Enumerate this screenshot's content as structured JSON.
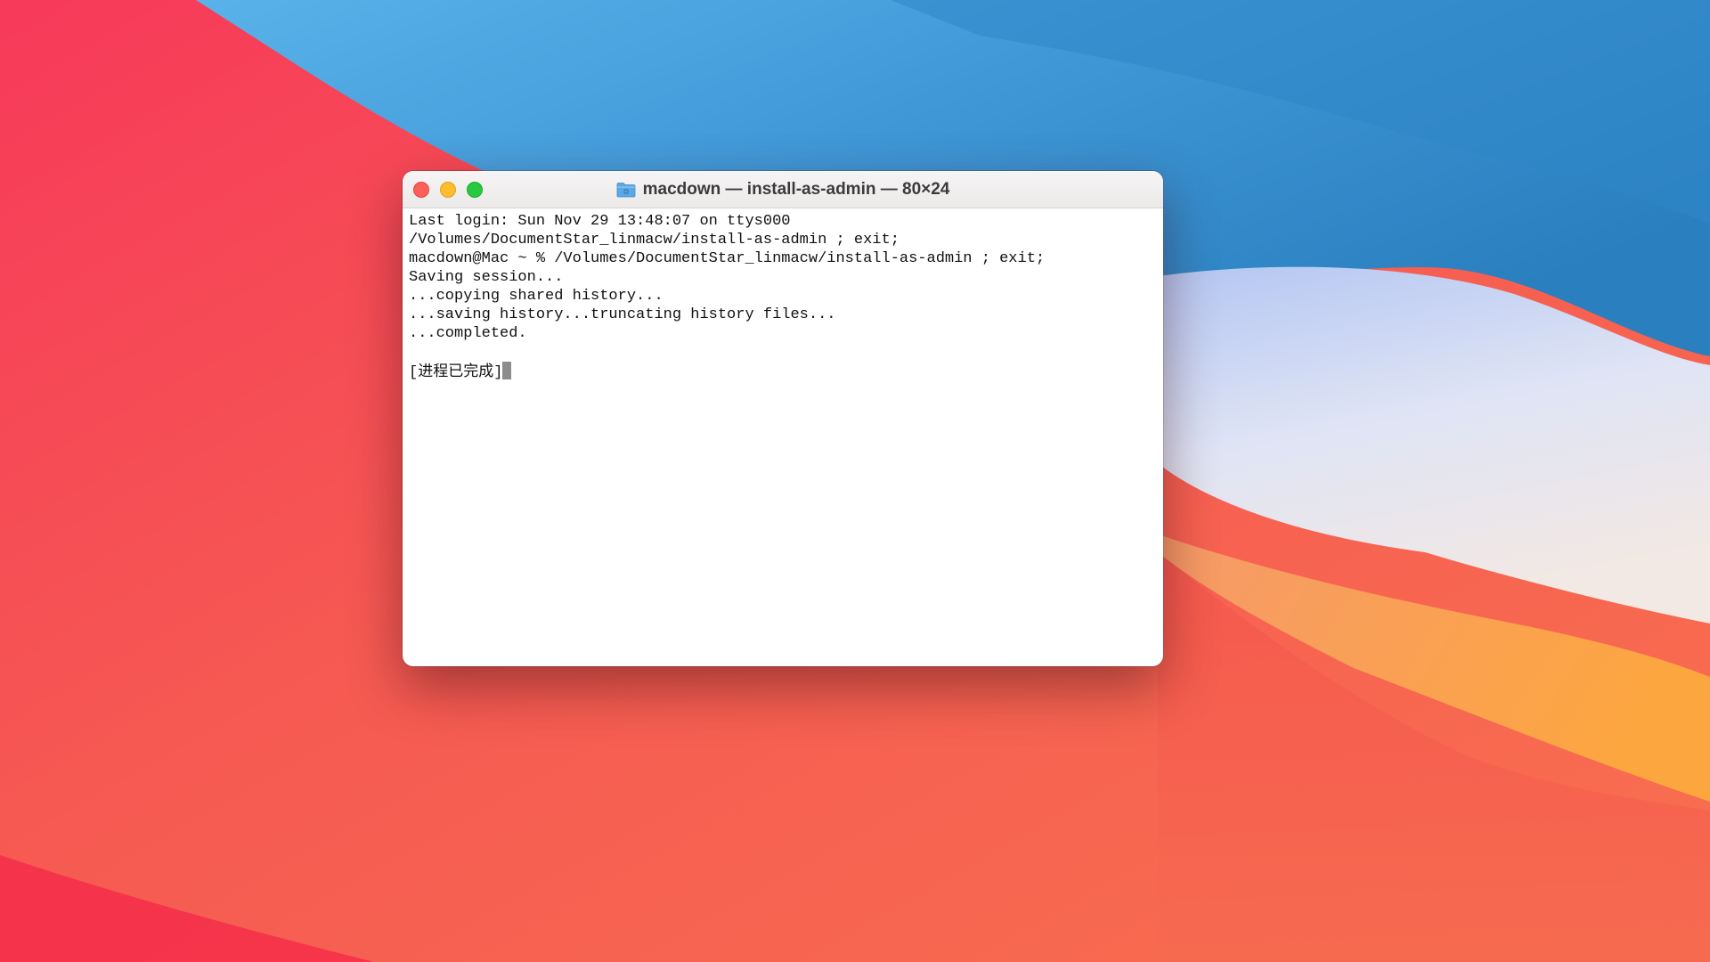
{
  "window": {
    "title": "macdown — install-as-admin — 80×24",
    "title_icon": "folder-icon",
    "buttons": {
      "close": "close-button",
      "minimize": "minimize-button",
      "zoom": "zoom-button"
    }
  },
  "terminal": {
    "lines": [
      "Last login: Sun Nov 29 13:48:07 on ttys000",
      "/Volumes/DocumentStar_linmacw/install-as-admin ; exit;",
      "macdown@Mac ~ % /Volumes/DocumentStar_linmacw/install-as-admin ; exit;",
      "Saving session...",
      "...copying shared history...",
      "...saving history...truncating history files...",
      "...completed.",
      "",
      "[进程已完成]"
    ]
  },
  "colors": {
    "close": "#fe5f57",
    "minimize": "#febc2e",
    "zoom": "#28c840",
    "folder": "#5aa9e6"
  }
}
